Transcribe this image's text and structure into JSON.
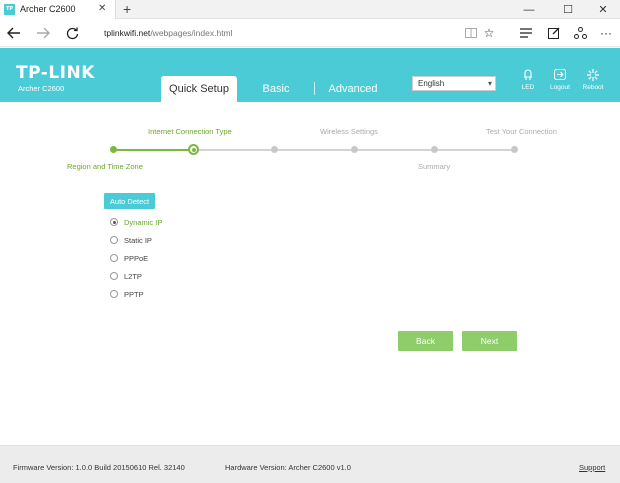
{
  "browser": {
    "tab_title": "Archer C2600",
    "favicon_text": "TP",
    "url_host": "tplinkwifi.net",
    "url_path": "/webpages/index.html",
    "window_controls": {
      "minimize": "—",
      "maximize": "☐",
      "close": "✕"
    },
    "icons": [
      "back-arrow-icon",
      "forward-arrow-icon",
      "refresh-icon",
      "reading-view-icon",
      "favorite-star-icon",
      "hub-icon",
      "web-note-icon",
      "share-icon",
      "more-icon"
    ]
  },
  "header": {
    "brand": "TP-LINK",
    "model": "Archer C2600",
    "tabs": [
      {
        "label": "Quick Setup",
        "active": true
      },
      {
        "label": "Basic",
        "active": false
      },
      {
        "label": "Advanced",
        "active": false
      }
    ],
    "language": "English",
    "tools": [
      {
        "label": "LED",
        "icon": "led-icon"
      },
      {
        "label": "Logout",
        "icon": "logout-icon"
      },
      {
        "label": "Reboot",
        "icon": "reboot-icon"
      }
    ],
    "accent_color": "#4acbd6"
  },
  "stepper": {
    "steps_top": [
      {
        "label": "Internet Connection Type",
        "state": "done"
      },
      {
        "label": "Wireless Settings",
        "state": "todo"
      },
      {
        "label": "Test Your Connection",
        "state": "todo"
      }
    ],
    "steps_bottom": [
      {
        "label": "Region and Time Zone",
        "state": "done"
      },
      {
        "label": "Summary",
        "state": "todo"
      }
    ],
    "progress_color": "#7bb93e",
    "pending_color": "#c8c8c8"
  },
  "form": {
    "auto_detect_label": "Auto Detect",
    "options": [
      {
        "label": "Dynamic IP",
        "checked": true
      },
      {
        "label": "Static IP",
        "checked": false
      },
      {
        "label": "PPPoE",
        "checked": false
      },
      {
        "label": "L2TP",
        "checked": false
      },
      {
        "label": "PPTP",
        "checked": false
      }
    ],
    "back_label": "Back",
    "next_label": "Next",
    "button_color": "#8fcc6a"
  },
  "footer": {
    "firmware": "Firmware Version: 1.0.0 Build 20150610 Rel. 32140",
    "hardware": "Hardware Version: Archer C2600 v1.0",
    "support": "Support"
  }
}
